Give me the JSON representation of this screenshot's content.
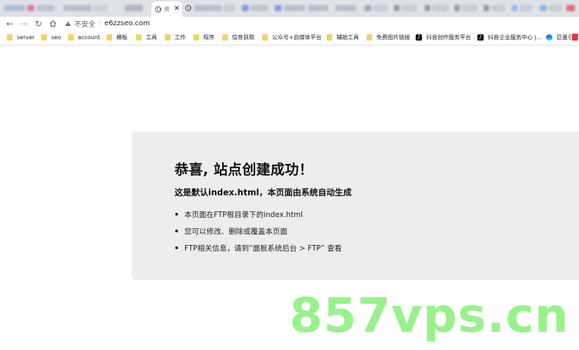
{
  "browser": {
    "active_tab": {
      "title_fragment": "资"
    },
    "url": "e6zzseo.com",
    "security_label": "不安全",
    "bookmarks": [
      {
        "label": "server",
        "icon": "folder-icon"
      },
      {
        "label": "seo",
        "icon": "folder-icon"
      },
      {
        "label": "account",
        "icon": "folder-icon"
      },
      {
        "label": "模板",
        "icon": "folder-icon"
      },
      {
        "label": "工具",
        "icon": "folder-icon"
      },
      {
        "label": "工作",
        "icon": "folder-icon"
      },
      {
        "label": "程序",
        "icon": "folder-icon"
      },
      {
        "label": "信息获取",
        "icon": "folder-icon"
      },
      {
        "label": "公众号+自媒体平台",
        "icon": "folder-icon"
      },
      {
        "label": "辅助工具",
        "icon": "folder-icon"
      },
      {
        "label": "免费图片链接",
        "icon": "folder-icon"
      },
      {
        "label": "抖音创作服务平台",
        "icon": "tiktok-icon"
      },
      {
        "label": "抖音企业服务中心 |...",
        "icon": "tiktok-icon"
      },
      {
        "label": "巨量引擎",
        "icon": "juliang-icon"
      }
    ]
  },
  "page": {
    "heading": "恭喜, 站点创建成功！",
    "subheading": "这是默认index.html，本页面由系统自动生成",
    "bullets": [
      "本页面在FTP根目录下的index.html",
      "您可以修改、删除或覆盖本页面",
      "FTP相关信息，请到“面板系统后台 > FTP” 查看"
    ]
  },
  "watermark": {
    "text": "857vps.cn",
    "color": "#8ef07f"
  },
  "colors": {
    "panel_bg": "#ededed",
    "tabstrip_bg": "#dee1e6",
    "folder": "#f3d16a"
  }
}
